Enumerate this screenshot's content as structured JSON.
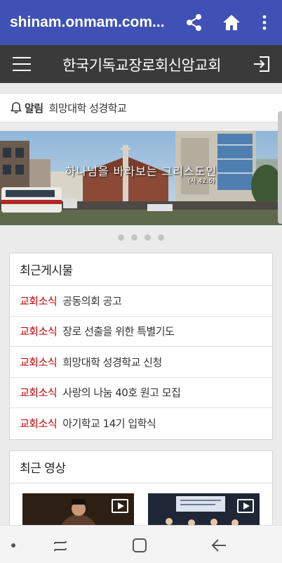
{
  "browser": {
    "url": "shinam.onmam.com...",
    "share_icon": "share-icon",
    "home_icon": "home-icon",
    "menu_icon": "more-vert-icon"
  },
  "site": {
    "title": "한국기독교장로회신암교회",
    "menu_icon": "hamburger-icon",
    "login_icon": "login-icon"
  },
  "notice": {
    "label": "알림",
    "text": "희망대학 성경학교"
  },
  "banner": {
    "caption": "하나님을 바라보는 그리스도인",
    "sub": "(사 42:6)",
    "slides": 4,
    "active_slide": 1
  },
  "recent_posts": {
    "heading": "최근게시물",
    "items": [
      {
        "category": "교회소식",
        "title": "공동의회 공고"
      },
      {
        "category": "교회소식",
        "title": "장로 선출을 위한 특별기도"
      },
      {
        "category": "교회소식",
        "title": "희망대학 성경학교 신청"
      },
      {
        "category": "교회소식",
        "title": "사랑의 나눔 40호 원고 모집"
      },
      {
        "category": "교회소식",
        "title": "아기학교 14기 입학식"
      }
    ]
  },
  "recent_videos": {
    "heading": "최근 영상"
  },
  "colors": {
    "browser_bar": "#3f51b5",
    "site_bar": "#3a3a3a",
    "category": "#c00000"
  }
}
